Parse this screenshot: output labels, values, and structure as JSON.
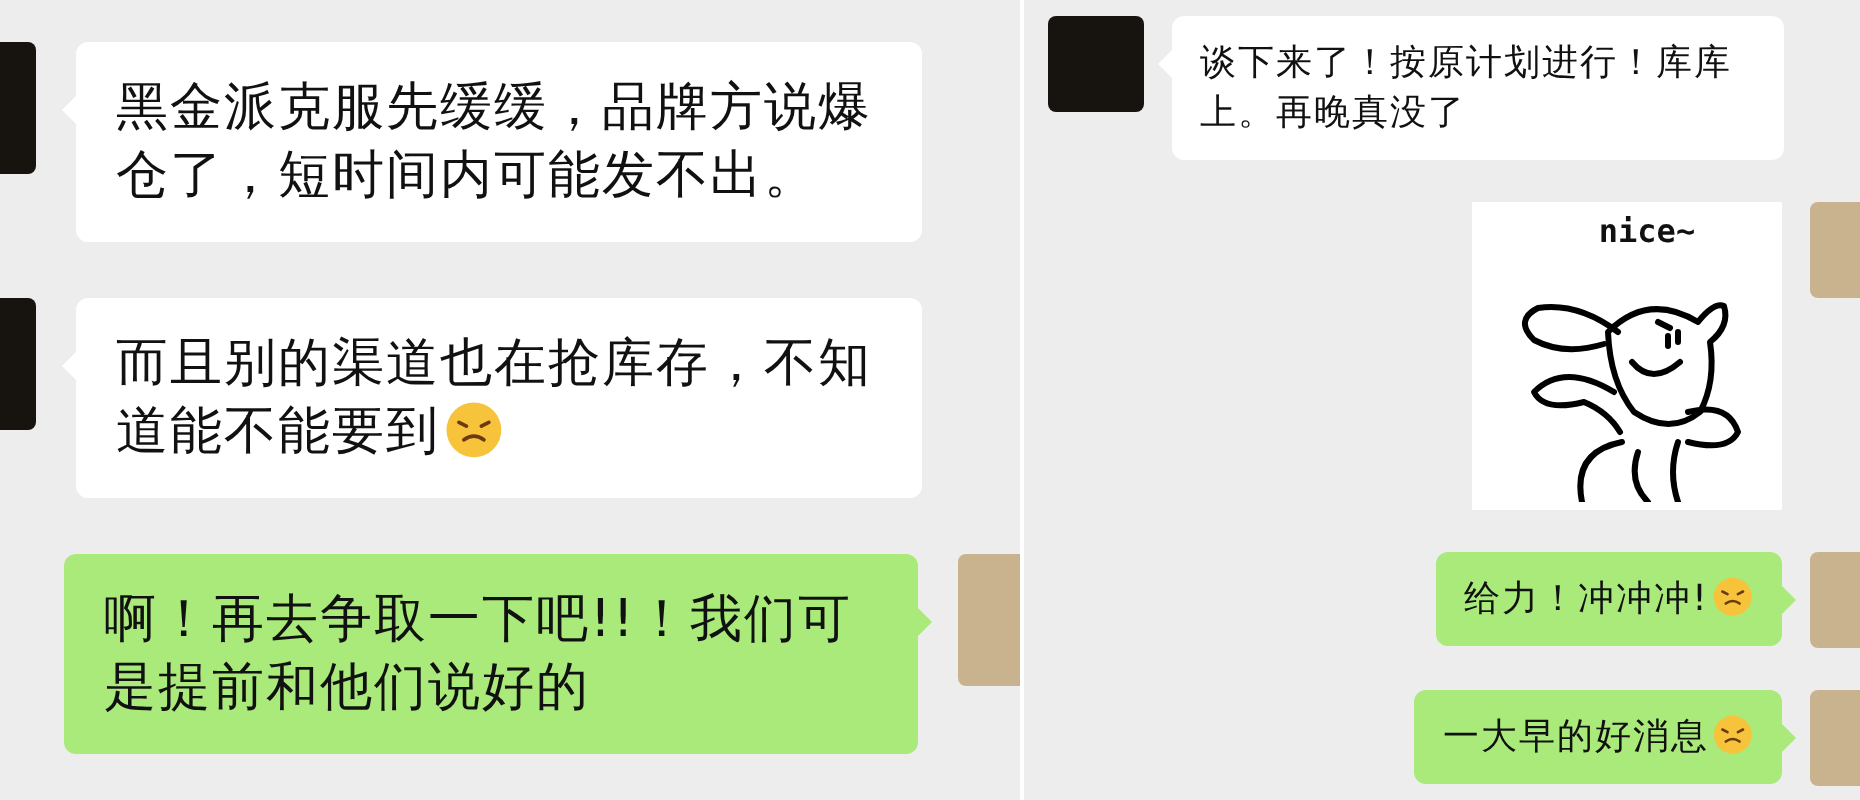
{
  "panes": [
    {
      "messages": [
        {
          "outgoing": false,
          "kind": "text",
          "text": "黑金派克服先缓缓，品牌方说爆仓了，短时间内可能发不出。",
          "emoji": false
        },
        {
          "outgoing": false,
          "kind": "text",
          "text": "而且别的渠道也在抢库存，不知道能不能要到",
          "emoji": true
        },
        {
          "outgoing": true,
          "kind": "text",
          "text": "啊！再去争取一下吧!!！我们可是提前和他们说好的",
          "emoji": false
        }
      ]
    },
    {
      "messages": [
        {
          "outgoing": false,
          "kind": "text",
          "text": "谈下来了！按原计划进行！库库上。再晚真没了",
          "emoji": false
        },
        {
          "outgoing": true,
          "kind": "sticker",
          "caption": "nice~"
        },
        {
          "outgoing": true,
          "kind": "text",
          "text": "给力！冲冲冲!",
          "emoji": true
        },
        {
          "outgoing": true,
          "kind": "text",
          "text": "一大早的好消息",
          "emoji": true
        }
      ]
    }
  ]
}
